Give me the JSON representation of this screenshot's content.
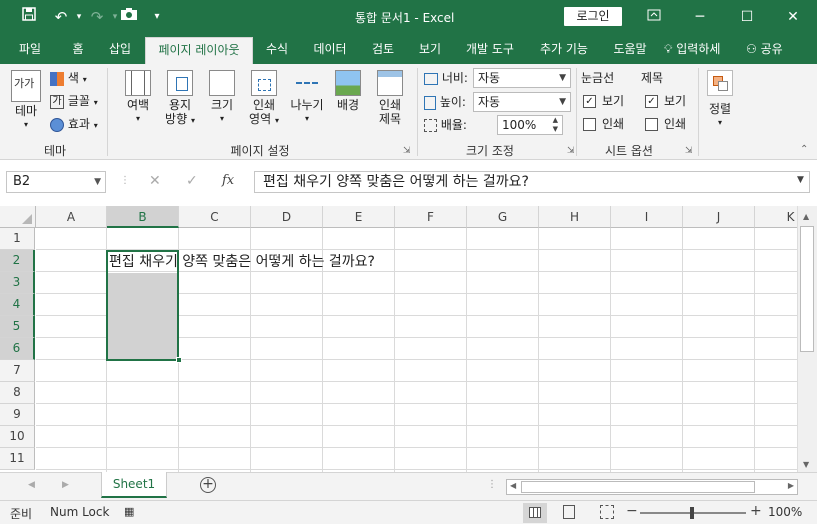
{
  "titlebar": {
    "title": "통합 문서1  -  Excel",
    "login": "로그인",
    "save_icon": "save-icon",
    "undo_icon": "undo-icon",
    "redo_icon": "redo-icon",
    "camera_icon": "camera-icon",
    "customize_icon": "customize-qat-icon",
    "ribbon_display_icon": "ribbon-display-icon",
    "minimize": "─",
    "maximize": "☐",
    "close": "✕"
  },
  "tabs": [
    "파일",
    "홈",
    "삽입",
    "페이지 레이아웃",
    "수식",
    "데이터",
    "검토",
    "보기",
    "개발 도구",
    "추가 기능",
    "도움말"
  ],
  "active_tab": "페이지 레이아웃",
  "tell_me": "입력하세",
  "share": "공유",
  "ribbon": {
    "theme": {
      "label": "테마",
      "group": "테마",
      "colors": "색",
      "fonts": "글꼴",
      "effects": "효과"
    },
    "page_setup": {
      "group": "페이지 설정",
      "margins": "여백",
      "orientation": [
        "용지",
        "방향"
      ],
      "size": "크기",
      "print_area": [
        "인쇄",
        "영역"
      ],
      "breaks": "나누기",
      "background": "배경",
      "print_titles": [
        "인쇄",
        "제목"
      ]
    },
    "scale": {
      "group": "크기 조정",
      "width_label": "너비:",
      "width_value": "자동",
      "height_label": "높이:",
      "height_value": "자동",
      "scale_label": "배율:",
      "scale_value": "100%"
    },
    "sheet_options": {
      "group": "시트 옵션",
      "gridlines": "눈금선",
      "headings": "제목",
      "view": "보기",
      "print": "인쇄"
    },
    "arrange": {
      "label": "정렬"
    }
  },
  "formula_bar": {
    "name_box": "B2",
    "fx": "fx",
    "formula": "편집 채우기 양쪽 맞춤은 어떻게 하는 걸까요?"
  },
  "grid": {
    "columns": [
      "A",
      "B",
      "C",
      "D",
      "E",
      "F",
      "G",
      "H",
      "I",
      "J",
      "K"
    ],
    "rows": [
      "1",
      "2",
      "3",
      "4",
      "5",
      "6",
      "7",
      "8",
      "9",
      "10",
      "11"
    ],
    "selected_column": "B",
    "selected_rows": [
      "2",
      "3",
      "4",
      "5",
      "6"
    ],
    "cell_B2": "편집 채우기 양쪽 맞춤은 어떻게 하는 걸까요?"
  },
  "sheets": {
    "active": "Sheet1",
    "add_icon": "add-sheet-icon"
  },
  "status_bar": {
    "mode": "준비",
    "numlock": "Num Lock",
    "zoom": "100%"
  },
  "colors": {
    "accent": "#217346",
    "selection": "#d2d2d2"
  }
}
